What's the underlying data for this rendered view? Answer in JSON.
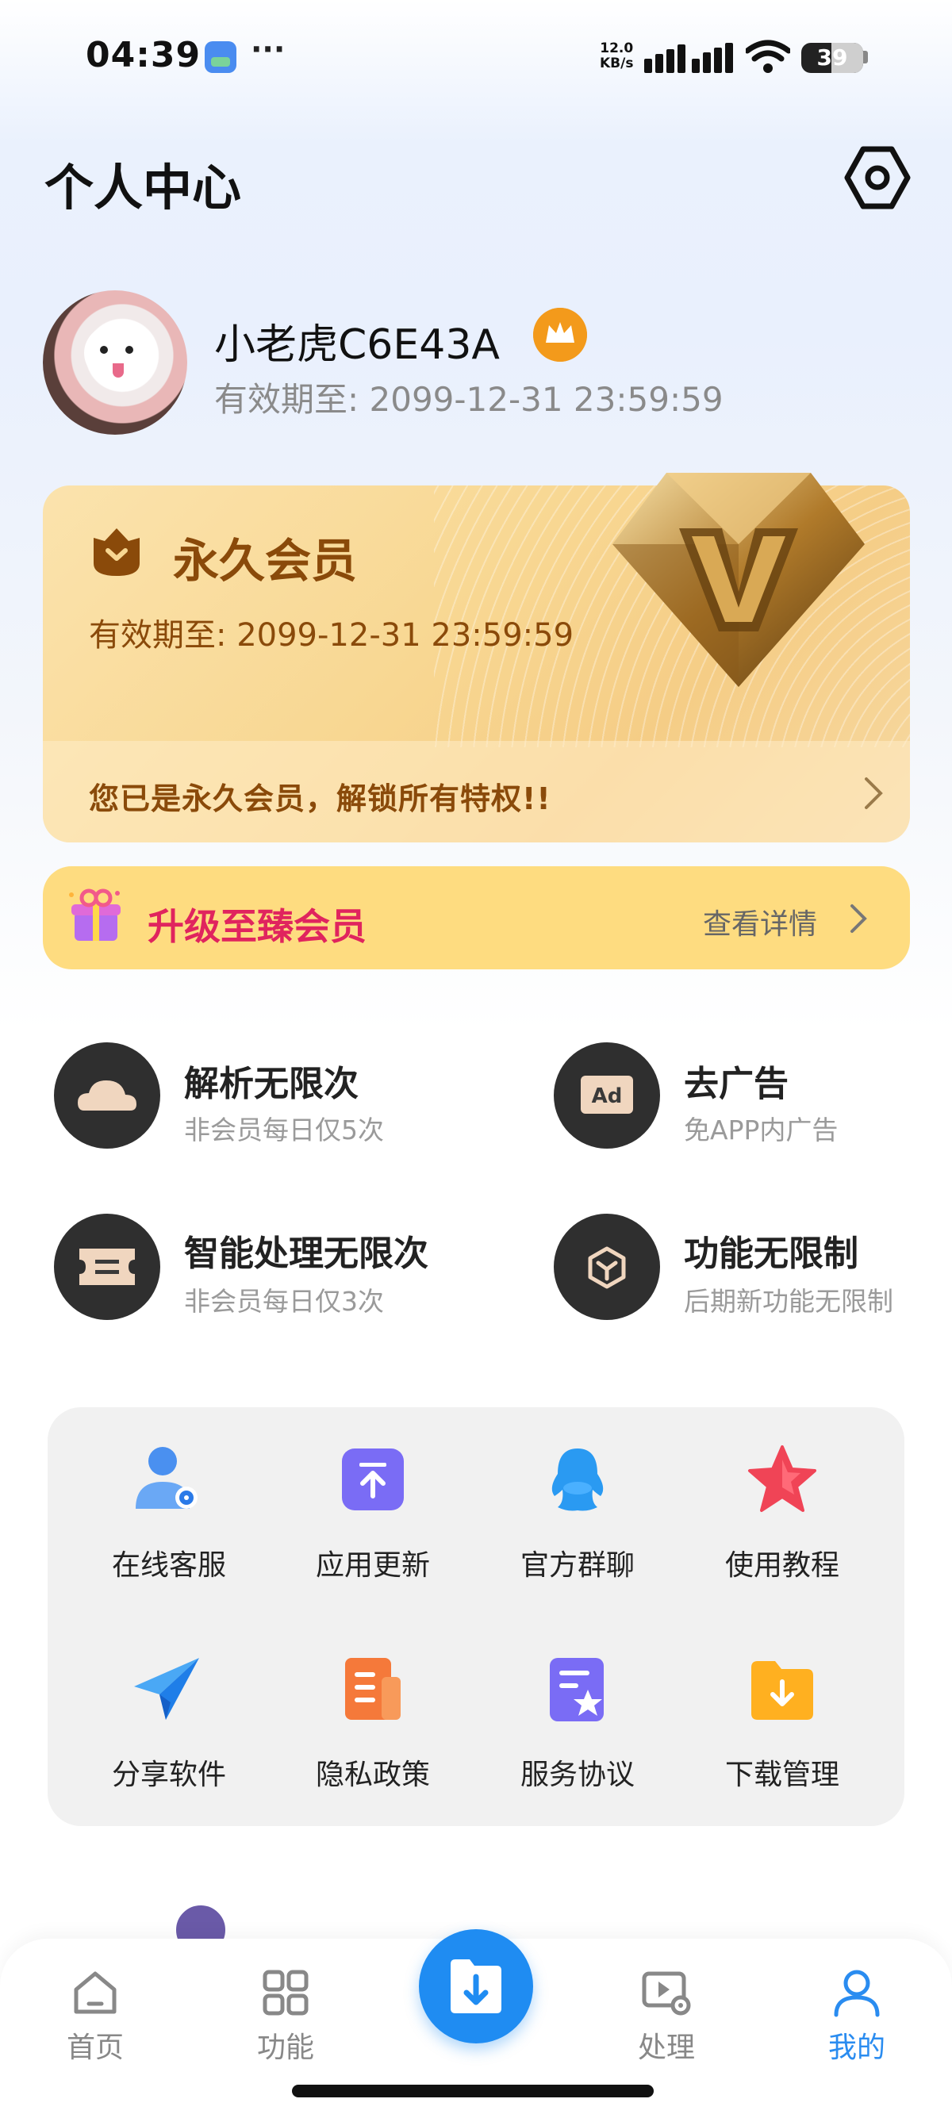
{
  "status_bar": {
    "time": "04:39",
    "more": "···",
    "net_speed_value": "12.0",
    "net_speed_unit": "KB/s",
    "battery": "39"
  },
  "header": {
    "title": "个人中心",
    "settings_icon": "hexagon-gear-icon"
  },
  "profile": {
    "name": "小老虎C6E43A",
    "expiry": "有效期至: 2099-12-31 23:59:59"
  },
  "member_card": {
    "title": "永久会员",
    "expiry": "有效期至: 2099-12-31 23:59:59",
    "note": "您已是永久会员，解锁所有特权!!",
    "colors": {
      "text": "#8a4a0a",
      "bg": "#f8d792"
    }
  },
  "upgrade": {
    "label": "升级至臻会员",
    "link": "查看详情",
    "colors": {
      "bg": "#fedc80",
      "label": "#e0245e"
    }
  },
  "benefits": [
    {
      "title": "解析无限次",
      "sub": "非会员每日仅5次",
      "icon": "cloud-icon"
    },
    {
      "title": "去广告",
      "sub": "免APP内广告",
      "icon": "ad-icon"
    },
    {
      "title": "智能处理无限次",
      "sub": "非会员每日仅3次",
      "icon": "ticket-icon"
    },
    {
      "title": "功能无限制",
      "sub": "后期新功能无限制",
      "icon": "cube-icon"
    }
  ],
  "shortcuts": [
    {
      "label": "在线客服",
      "icon": "customer-service-icon"
    },
    {
      "label": "应用更新",
      "icon": "update-icon"
    },
    {
      "label": "官方群聊",
      "icon": "qq-group-icon"
    },
    {
      "label": "使用教程",
      "icon": "star-tutorial-icon"
    },
    {
      "label": "分享软件",
      "icon": "paper-plane-icon"
    },
    {
      "label": "隐私政策",
      "icon": "privacy-doc-icon"
    },
    {
      "label": "服务协议",
      "icon": "agreement-doc-icon"
    },
    {
      "label": "下载管理",
      "icon": "download-folder-icon"
    }
  ],
  "tabs": [
    {
      "label": "首页",
      "icon": "home-icon",
      "active": false
    },
    {
      "label": "功能",
      "icon": "grid-icon",
      "active": false
    },
    {
      "label": "处理",
      "icon": "video-settings-icon",
      "active": false
    },
    {
      "label": "我的",
      "icon": "person-icon",
      "active": true
    }
  ],
  "colors": {
    "accent": "#2a8cf0",
    "fab": "#1f8cf2"
  }
}
